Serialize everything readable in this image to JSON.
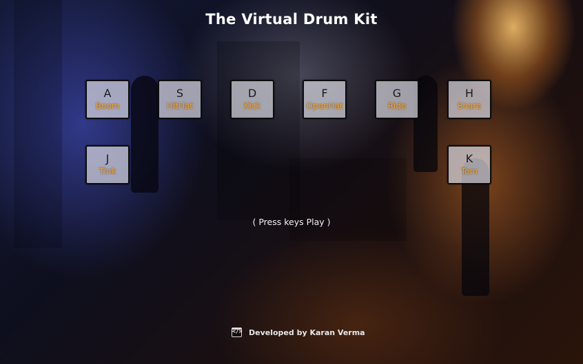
{
  "app": {
    "title": "The Virtual Drum Kit"
  },
  "keys": [
    {
      "letter": "A",
      "sound": "Boom"
    },
    {
      "letter": "S",
      "sound": "HitHat"
    },
    {
      "letter": "D",
      "sound": "Kick"
    },
    {
      "letter": "F",
      "sound": "OpenHat"
    },
    {
      "letter": "G",
      "sound": "Ride"
    },
    {
      "letter": "H",
      "sound": "Snare"
    },
    {
      "letter": "J",
      "sound": "Tink"
    },
    {
      "letter": "K",
      "sound": "Tom"
    }
  ],
  "hint": "( Press keys Play )",
  "footer": {
    "icon": "code-icon",
    "credit": "Developed by Karan Verma"
  },
  "colors": {
    "sound_label": "#f0a43a",
    "key_border": "#0c0c0c"
  }
}
